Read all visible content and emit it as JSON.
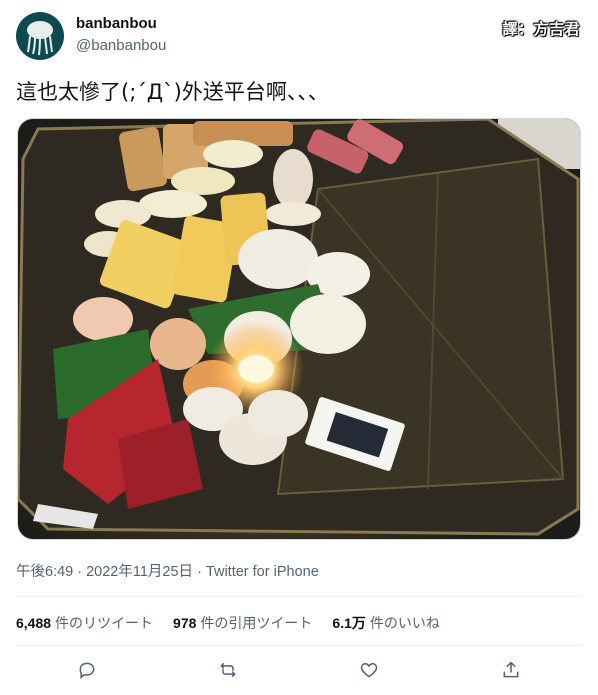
{
  "tweet": {
    "display_name": "banbanbou",
    "handle": "@banbanbou",
    "translator_label": "譯：方吉君",
    "text": "這也太慘了(;´Д`)外送平台啊、、、",
    "timestamp": "午後6:49 · 2022年11月25日 · Twitter for iPhone"
  },
  "stats": {
    "retweets_count": "6,488",
    "retweets_label": "件のリツイート",
    "quotes_count": "978",
    "quotes_label": "件の引用ツイート",
    "likes_count": "6.1万",
    "likes_label": "件のいいね"
  },
  "icons": {
    "reply": "reply-icon",
    "retweet": "retweet-icon",
    "like": "heart-icon",
    "share": "share-icon"
  }
}
